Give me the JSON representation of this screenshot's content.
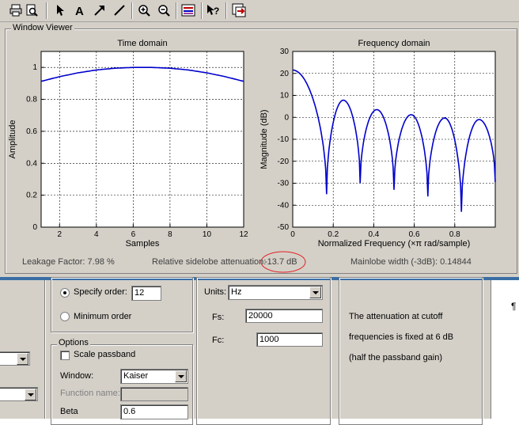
{
  "toolbar": {
    "icons": [
      "print-icon",
      "print-preview-icon",
      "select-arrow-icon",
      "insert-text-icon",
      "insert-arrow-icon",
      "insert-line-icon",
      "zoom-in-icon",
      "zoom-out-icon",
      "legend-icon",
      "whats-this-icon",
      "full-view-icon"
    ]
  },
  "viewer": {
    "title": "Window Viewer",
    "leakage_factor": "Leakage Factor: 7.98 %",
    "sidelobe_label": "Relative sidelobe attenuation:",
    "sidelobe_value": "-13.7 dB",
    "mainlobe_width": "Mainlobe width (-3dB): 0.14844"
  },
  "chart_data": [
    {
      "type": "line",
      "title": "Time domain",
      "xlabel": "Samples",
      "ylabel": "Amplitude",
      "xlim": [
        1,
        12
      ],
      "ylim": [
        0,
        1.1
      ],
      "xticks": [
        2,
        4,
        6,
        8,
        10,
        12
      ],
      "yticks": [
        0,
        0.2,
        0.4,
        0.6,
        0.8,
        1
      ],
      "ytick_labels": [
        "0",
        "0.2",
        "0.4",
        "0.6",
        "0.8",
        "1"
      ],
      "grid": true,
      "series": [
        {
          "color": "#0000cc",
          "x": [
            1,
            2,
            3,
            4,
            5,
            6,
            7,
            8,
            9,
            10,
            11,
            12
          ],
          "y": [
            0.913,
            0.942,
            0.966,
            0.984,
            0.995,
            1.0,
            1.0,
            0.995,
            0.984,
            0.966,
            0.942,
            0.913
          ]
        }
      ]
    },
    {
      "type": "line",
      "title": "Frequency domain",
      "xlabel": "Normalized Frequency  (×π rad/sample)",
      "ylabel": "Magnitude (dB)",
      "xlim": [
        0,
        1
      ],
      "ylim": [
        -50,
        30
      ],
      "xticks": [
        0,
        0.2,
        0.4,
        0.6,
        0.8
      ],
      "xtick_labels": [
        "0",
        "0.2",
        "0.4",
        "0.6",
        "0.8"
      ],
      "yticks": [
        -50,
        -40,
        -30,
        -20,
        -10,
        0,
        10,
        20,
        30
      ],
      "grid": true,
      "series": [
        {
          "color": "#0000cc",
          "nulls": [
            0.167,
            0.333,
            0.5,
            0.667,
            0.833
          ],
          "null_depths": [
            -35,
            -30,
            -33,
            -36,
            -43
          ],
          "peaks": [
            {
              "x": 0.0,
              "y": 21.5
            },
            {
              "x": 0.25,
              "y": 7.8
            },
            {
              "x": 0.415,
              "y": 3.5
            },
            {
              "x": 0.585,
              "y": 1.2
            },
            {
              "x": 0.75,
              "y": -0.3
            },
            {
              "x": 0.92,
              "y": -1.0
            }
          ],
          "end": {
            "x": 1.0,
            "y": -29.5
          }
        }
      ]
    }
  ],
  "order": {
    "specify_label": "Specify order:",
    "specify_value": "12",
    "minimum_label": "Minimum order"
  },
  "options": {
    "title": "Options",
    "scale_passband": "Scale passband",
    "window_label": "Window:",
    "window_value": "Kaiser",
    "function_label": "Function name:",
    "beta_label": "Beta",
    "beta_value": "0.6"
  },
  "frequency": {
    "units_label": "Units:",
    "units_value": "Hz",
    "fs_label": "Fs:",
    "fs_value": "20000",
    "fc_label": "Fc:",
    "fc_value": "1000"
  },
  "info": {
    "line1": "The attenuation at cutoff",
    "line2": "frequencies is fixed at 6 dB",
    "line3": "(half the passband gain)"
  },
  "right_panel": {
    "pilcrow": "¶"
  }
}
